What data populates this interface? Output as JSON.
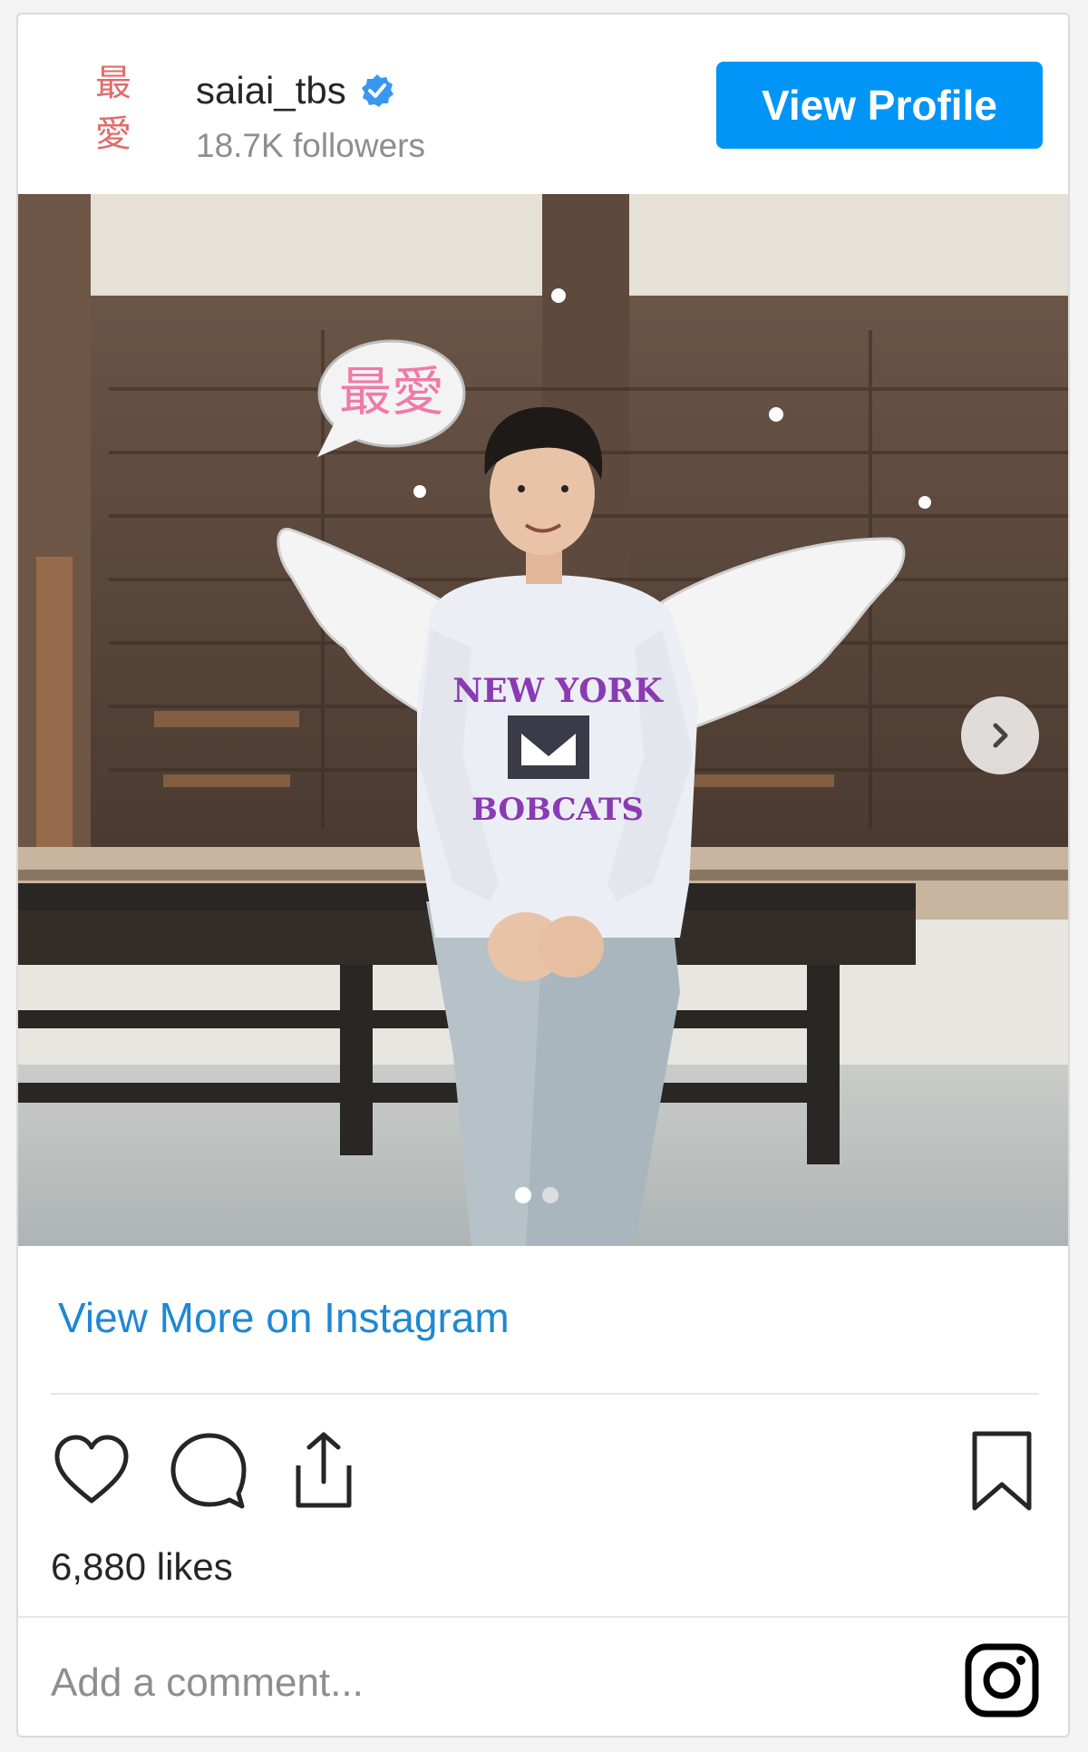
{
  "header": {
    "avatar_text_line1": "最",
    "avatar_text_line2": "愛",
    "username": "saiai_tbs",
    "verified_icon": "verified-badge-icon",
    "followers": "18.7K followers",
    "view_profile_label": "View Profile"
  },
  "photo": {
    "speech_bubble_text": "最愛",
    "shirt_text_top": "NEW YORK",
    "shirt_text_bottom": "BOBCATS",
    "next_icon": "chevron-right-icon",
    "carousel": {
      "total": 2,
      "active": 1
    }
  },
  "footer": {
    "view_more_label": "View More on Instagram",
    "icons": [
      "heart-icon",
      "comment-icon",
      "share-icon",
      "bookmark-icon"
    ],
    "likes": "6,880 likes",
    "comment_placeholder": "Add a comment...",
    "instagram_icon": "instagram-icon"
  },
  "colors": {
    "accent_blue": "#0095f6",
    "link_blue": "#1e88d4",
    "verified_blue": "#3897f0",
    "avatar_red": "#e06b6b"
  }
}
